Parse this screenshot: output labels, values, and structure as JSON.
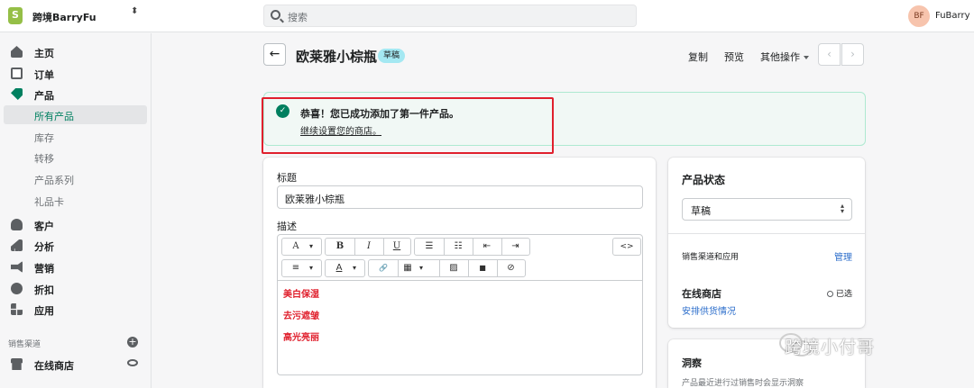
{
  "topbar": {
    "store_name": "跨境BarryFu",
    "store_switch_icon": "⬍",
    "search_placeholder": "搜索",
    "avatar_initials": "BF",
    "user_name": "FuBarry"
  },
  "sidebar": {
    "items": [
      {
        "label": "主页",
        "icon": "home-icon"
      },
      {
        "label": "订单",
        "icon": "orders-icon"
      },
      {
        "label": "产品",
        "icon": "tag-icon"
      },
      {
        "label": "客户",
        "icon": "person-icon"
      },
      {
        "label": "分析",
        "icon": "bar-chart-icon"
      },
      {
        "label": "营销",
        "icon": "megaphone-icon"
      },
      {
        "label": "折扣",
        "icon": "discount-icon"
      },
      {
        "label": "应用",
        "icon": "apps-icon"
      }
    ],
    "product_sub": [
      "所有产品",
      "库存",
      "转移",
      "产品系列",
      "礼品卡"
    ],
    "channels_label": "销售渠道",
    "online_store": "在线商店"
  },
  "header": {
    "back_icon": "←",
    "title": "欧莱雅小棕瓶",
    "badge": "草稿",
    "copy": "复制",
    "preview": "预览",
    "more_actions": "其他操作",
    "prev_icon": "‹",
    "next_icon": "›"
  },
  "banner": {
    "check": "✓",
    "title": "恭喜！您已成功添加了第一件产品。",
    "link": "继续设置您的商店。"
  },
  "form": {
    "title_label": "标题",
    "title_value": "欧莱雅小棕瓶",
    "desc_label": "描述",
    "toolbar": {
      "font": "A",
      "bold": "B",
      "italic": "I",
      "underline": "U",
      "bullets": "☰",
      "numbers": "☷",
      "outdent": "⇤",
      "indent": "⇥",
      "code": "<>",
      "align": "≡",
      "color": "A",
      "link": "🔗",
      "table": "▦",
      "image": "▨",
      "video": "■",
      "clear": "⊘",
      "caret": "▾"
    },
    "desc_lines": [
      "美白保湿",
      "去污遮皱",
      "高光亮丽"
    ]
  },
  "status_card": {
    "title": "产品状态",
    "select_value": "草稿",
    "select_caret": "▴▾",
    "channels_label": "销售渠道和应用",
    "manage": "管理",
    "online_store": "在线商店",
    "selected": "已选",
    "schedule_link": "安排供货情况"
  },
  "insight_card": {
    "title": "洞察",
    "text": "产品最近进行过销售时会显示洞察"
  },
  "watermark": "跨境小付哥",
  "colors": {
    "accent": "#008060",
    "highlight": "#e0202d",
    "badge": "#a4e8f2",
    "banner_bg": "#f1f8f5"
  }
}
